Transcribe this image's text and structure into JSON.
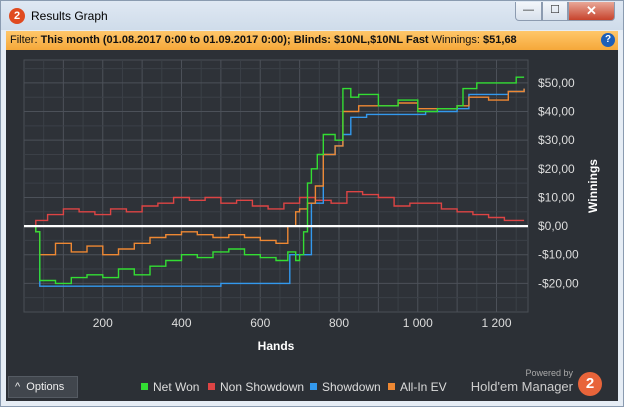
{
  "window": {
    "title": "Results Graph",
    "app_icon": "2"
  },
  "window_controls": {
    "minimize": "—",
    "maximize": "☐",
    "close": "✕"
  },
  "filter": {
    "label": "Filter: ",
    "range": "This month (01.08.2017 0:00 to 01.09.2017 0:00)",
    "blinds_label": "; Blinds: ",
    "blinds": "$10NL,$10NL Fast",
    "winnings_label": "  Winnings: ",
    "winnings": "$51,68",
    "help_icon": "?"
  },
  "options_label": "Options",
  "options_icon": "^",
  "branding": {
    "powered": "Powered by",
    "name": "Hold'em Manager",
    "logo": "2"
  },
  "colors": {
    "net_won": "#33dd33",
    "non_showdown": "#dd4444",
    "showdown": "#3399ee",
    "allin_ev": "#ee8833",
    "zero_line": "#ffffff"
  },
  "chart_data": {
    "type": "line",
    "xlabel": "Hands",
    "ylabel": "Winnings",
    "xlim": [
      0,
      1280
    ],
    "ylim": [
      -30,
      58
    ],
    "x_ticks": [
      200,
      400,
      600,
      800,
      1000,
      1200
    ],
    "x_tick_labels": [
      "200",
      "400",
      "600",
      "800",
      "1 000",
      "1 200"
    ],
    "y_ticks": [
      -20,
      -10,
      0,
      10,
      20,
      30,
      40,
      50
    ],
    "y_tick_labels": [
      "-$20,00",
      "-$10,00",
      "$0,00",
      "$10,00",
      "$20,00",
      "$30,00",
      "$40,00",
      "$50,00"
    ],
    "grid": true,
    "legend": "bottom",
    "series": [
      {
        "name": "Net Won",
        "x": [
          0,
          30,
          40,
          80,
          120,
          160,
          200,
          240,
          280,
          320,
          360,
          400,
          440,
          480,
          520,
          560,
          600,
          640,
          670,
          690,
          700,
          710,
          720,
          730,
          745,
          760,
          790,
          810,
          830,
          850,
          900,
          950,
          1000,
          1050,
          1100,
          1115,
          1150,
          1200,
          1250,
          1270
        ],
        "y": [
          0,
          -2,
          -19,
          -20,
          -18,
          -17,
          -18,
          -15,
          -17,
          -14,
          -12,
          -10,
          -11,
          -9,
          -8,
          -10,
          -11,
          -12,
          -9,
          -12,
          -10,
          -2,
          15,
          20,
          25,
          32,
          30,
          48,
          45,
          46,
          42,
          44,
          40,
          41,
          42,
          48,
          50,
          50,
          52,
          52
        ]
      },
      {
        "name": "Non Showdown",
        "x": [
          0,
          30,
          60,
          100,
          140,
          180,
          220,
          260,
          300,
          340,
          380,
          420,
          460,
          500,
          540,
          580,
          620,
          660,
          700,
          740,
          780,
          820,
          860,
          900,
          940,
          980,
          1020,
          1060,
          1100,
          1140,
          1180,
          1220,
          1250,
          1270
        ],
        "y": [
          0,
          2,
          4,
          6,
          5,
          4,
          6,
          5,
          7,
          8,
          10,
          9,
          10,
          8,
          9,
          7,
          6,
          8,
          10,
          9,
          8,
          12,
          11,
          10,
          7,
          8,
          8,
          6,
          5,
          4,
          3,
          2,
          2,
          2
        ]
      },
      {
        "name": "Showdown",
        "x": [
          0,
          30,
          40,
          100,
          150,
          200,
          300,
          400,
          500,
          600,
          660,
          675,
          700,
          730,
          760,
          790,
          810,
          830,
          870,
          920,
          970,
          1020,
          1060,
          1100,
          1130,
          1180,
          1230,
          1270
        ],
        "y": [
          0,
          -2,
          -21,
          -21,
          -21,
          -21,
          -21,
          -21,
          -20,
          -20,
          -20,
          -10,
          -10,
          8,
          25,
          28,
          32,
          38,
          39,
          39,
          39,
          40,
          40,
          41,
          46,
          46,
          47,
          48
        ]
      },
      {
        "name": "All-In EV",
        "x": [
          0,
          30,
          40,
          80,
          120,
          160,
          200,
          240,
          280,
          320,
          360,
          400,
          440,
          480,
          520,
          560,
          600,
          640,
          670,
          690,
          700,
          720,
          740,
          760,
          790,
          810,
          850,
          900,
          950,
          1000,
          1050,
          1100,
          1130,
          1180,
          1230,
          1270
        ],
        "y": [
          0,
          -2,
          -10,
          -6,
          -9,
          -7,
          -10,
          -8,
          -6,
          -4,
          -3,
          -2,
          -3,
          -4,
          -3,
          -4,
          -5,
          -6,
          0,
          5,
          6,
          8,
          14,
          25,
          28,
          40,
          42,
          42,
          43,
          41,
          41,
          42,
          45,
          44,
          47,
          48
        ]
      }
    ]
  }
}
